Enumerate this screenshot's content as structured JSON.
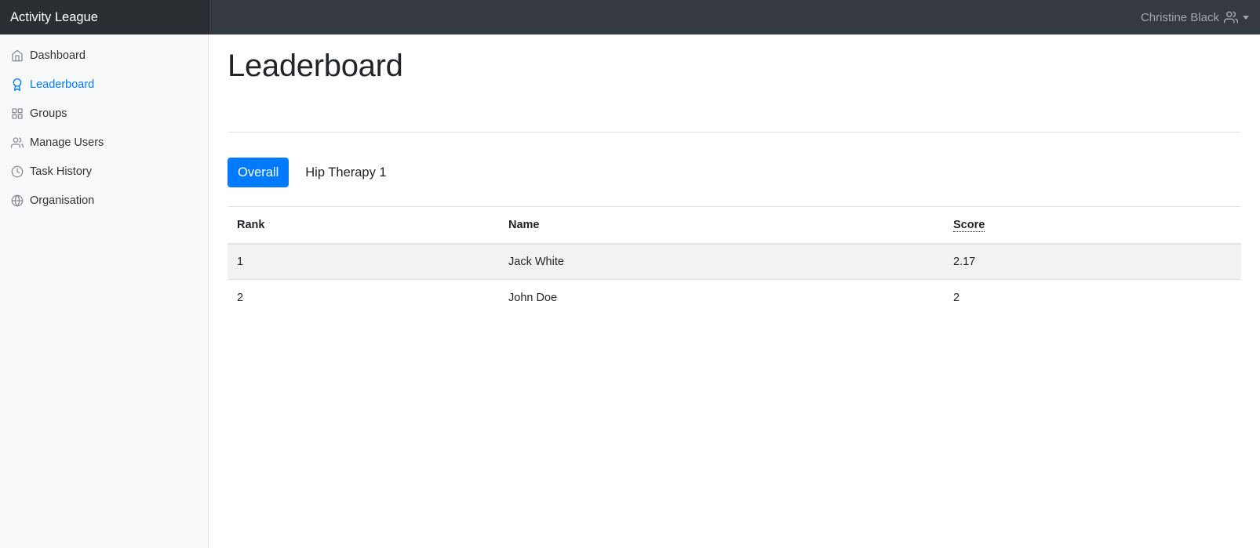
{
  "app": {
    "title": "Activity League"
  },
  "user": {
    "name": "Christine Black"
  },
  "sidebar": {
    "items": [
      {
        "label": "Dashboard",
        "icon": "home-icon",
        "active": false
      },
      {
        "label": "Leaderboard",
        "icon": "award-icon",
        "active": true
      },
      {
        "label": "Groups",
        "icon": "grid-icon",
        "active": false
      },
      {
        "label": "Manage Users",
        "icon": "users-icon",
        "active": false
      },
      {
        "label": "Task History",
        "icon": "clock-icon",
        "active": false
      },
      {
        "label": "Organisation",
        "icon": "globe-icon",
        "active": false
      }
    ]
  },
  "main": {
    "title": "Leaderboard",
    "tabs": [
      {
        "label": "Overall",
        "active": true
      },
      {
        "label": "Hip Therapy 1",
        "active": false
      }
    ],
    "table": {
      "headers": {
        "rank": "Rank",
        "name": "Name",
        "score": "Score"
      },
      "rows": [
        {
          "rank": "1",
          "name": "Jack White",
          "score": "2.17"
        },
        {
          "rank": "2",
          "name": "John Doe",
          "score": "2"
        }
      ]
    }
  },
  "colors": {
    "accent": "#007bff",
    "topbar": "#343a40",
    "brand_bg": "#2a2e33",
    "sidebar_bg": "#f8f9fa"
  }
}
